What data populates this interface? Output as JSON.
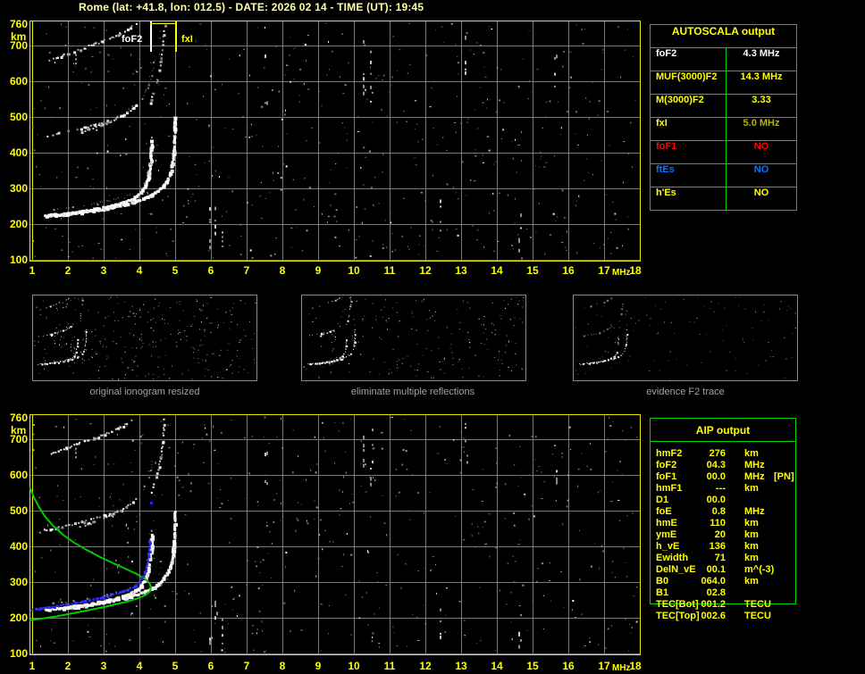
{
  "title": "Rome (lat: +41.8, lon: 012.5) - DATE: 2026 02 14 - TIME (UT): 19:45",
  "colors": {
    "background": "#000000",
    "axis_text": "#ffff00",
    "title_text": "#ffffa6",
    "grid": "#787878",
    "plot_border": "#e8e800",
    "table_border": "#00d400",
    "trace_white": "#ffffff",
    "profile_green": "#00cc00",
    "restored_blue": "#2525ff",
    "caption_gray": "#a2a2a2",
    "red": "#ff0000",
    "blue_text": "#0078ff",
    "olive_value": "#b4b400"
  },
  "annotations": {
    "foF2_label": "foF2",
    "fxI_label": "fxI",
    "foF2_mhz": 4.3,
    "fxI_mhz": 5.0
  },
  "axes": {
    "x_ticks": [
      1,
      2,
      3,
      4,
      5,
      6,
      7,
      8,
      9,
      10,
      11,
      12,
      13,
      14,
      15,
      16,
      17,
      18
    ],
    "x_unit": "MHz",
    "y_ticks": [
      760,
      700,
      600,
      500,
      400,
      300,
      200,
      100
    ],
    "y_unit": "km"
  },
  "autoscala_table": {
    "header": "AUTOSCALA output",
    "rows": [
      {
        "label": "foF2",
        "label_color": "#ffffff",
        "value": "4.3 MHz",
        "value_color": "#ffffff"
      },
      {
        "label": "MUF(3000)F2",
        "label_color": "#ffff00",
        "value": "14.3 MHz",
        "value_color": "#ffff00"
      },
      {
        "label": "M(3000)F2",
        "label_color": "#ffff00",
        "value": "3.33",
        "value_color": "#ffff00"
      },
      {
        "label": "fxI",
        "label_color": "#ffff00",
        "value": "5.0 MHz",
        "value_color": "#b4b400"
      },
      {
        "label": "foF1",
        "label_color": "#ff0000",
        "value": "NO",
        "value_color": "#ff0000"
      },
      {
        "label": "ftEs",
        "label_color": "#0078ff",
        "value": "NO",
        "value_color": "#0078ff"
      },
      {
        "label": "h'Es",
        "label_color": "#ffff00",
        "value": "NO",
        "value_color": "#ffff00"
      }
    ]
  },
  "aip_table": {
    "header": "AIP output",
    "rows": [
      {
        "label": "hmF2",
        "value": "276",
        "unit": "km",
        "note": ""
      },
      {
        "label": "foF2",
        "value": "04.3",
        "unit": "MHz",
        "note": ""
      },
      {
        "label": "foF1",
        "value": "00.0",
        "unit": "MHz",
        "note": "[PN]"
      },
      {
        "label": "hmF1",
        "value": "---",
        "unit": "km",
        "note": ""
      },
      {
        "label": "D1",
        "value": "00.0",
        "unit": "",
        "note": ""
      },
      {
        "label": "foE",
        "value": "0.8",
        "unit": "MHz",
        "note": ""
      },
      {
        "label": "hmE",
        "value": "110",
        "unit": "km",
        "note": ""
      },
      {
        "label": "ymE",
        "value": "20",
        "unit": "km",
        "note": ""
      },
      {
        "label": "h_vE",
        "value": "136",
        "unit": "km",
        "note": ""
      },
      {
        "label": "Ewidth",
        "value": "71",
        "unit": "km",
        "note": ""
      },
      {
        "label": "DelN_vE",
        "value": "00.1",
        "unit": "m^(-3)",
        "note": ""
      },
      {
        "label": "B0",
        "value": "064.0",
        "unit": "km",
        "note": ""
      },
      {
        "label": "B1",
        "value": "02.8",
        "unit": "",
        "note": ""
      },
      {
        "label": "TEC[Bot]",
        "value": "001.2",
        "unit": "TECU",
        "note": ""
      },
      {
        "label": "TEC[Top]",
        "value": "002.6",
        "unit": "TECU",
        "note": ""
      }
    ]
  },
  "thumbnails": [
    {
      "caption": "original ionogram resized"
    },
    {
      "caption": "eliminate multiple reflections"
    },
    {
      "caption": "evidence F2 trace"
    }
  ],
  "chart_data": {
    "type": "scatter",
    "x_unit": "MHz",
    "y_unit": "km",
    "x_range": [
      1,
      18
    ],
    "y_range": [
      100,
      760
    ],
    "grid": true,
    "traces": {
      "f2_ordinary": [
        [
          1.32,
          227
        ],
        [
          1.6,
          229
        ],
        [
          1.9,
          232
        ],
        [
          2.2,
          236
        ],
        [
          2.5,
          241
        ],
        [
          2.8,
          246
        ],
        [
          3.1,
          252
        ],
        [
          3.35,
          258
        ],
        [
          3.55,
          264
        ],
        [
          3.75,
          272
        ],
        [
          3.9,
          281
        ],
        [
          4.02,
          292
        ],
        [
          4.12,
          306
        ],
        [
          4.19,
          323
        ],
        [
          4.24,
          344
        ],
        [
          4.275,
          369
        ],
        [
          4.295,
          396
        ],
        [
          4.31,
          422
        ],
        [
          4.315,
          435
        ]
      ],
      "f2_extraordinary": [
        [
          1.75,
          229
        ],
        [
          2.05,
          232
        ],
        [
          2.35,
          236
        ],
        [
          2.65,
          240
        ],
        [
          2.95,
          245
        ],
        [
          3.25,
          251
        ],
        [
          3.55,
          258
        ],
        [
          3.85,
          266
        ],
        [
          4.1,
          275
        ],
        [
          4.3,
          285
        ],
        [
          4.5,
          297
        ],
        [
          4.65,
          311
        ],
        [
          4.76,
          327
        ],
        [
          4.84,
          347
        ],
        [
          4.895,
          372
        ],
        [
          4.93,
          400
        ],
        [
          4.95,
          432
        ],
        [
          4.96,
          465
        ],
        [
          4.965,
          500
        ]
      ],
      "second_reflection_a": [
        [
          1.3,
          447
        ],
        [
          1.65,
          454
        ],
        [
          2.0,
          462
        ],
        [
          2.35,
          470
        ],
        [
          2.7,
          479
        ],
        [
          3.0,
          488
        ],
        [
          3.3,
          498
        ],
        [
          3.55,
          508
        ]
      ],
      "second_reflection_b": [
        [
          2.3,
          457
        ],
        [
          2.6,
          467
        ],
        [
          2.9,
          478
        ],
        [
          3.2,
          490
        ],
        [
          3.45,
          503
        ],
        [
          3.65,
          516
        ],
        [
          3.8,
          528
        ],
        [
          3.95,
          542
        ]
      ],
      "second_reflection_c": [
        [
          4.28,
          543
        ],
        [
          4.38,
          568
        ],
        [
          4.47,
          598
        ],
        [
          4.54,
          632
        ],
        [
          4.6,
          668
        ],
        [
          4.64,
          705
        ],
        [
          4.67,
          742
        ],
        [
          4.68,
          758
        ]
      ],
      "second_reflection_d": [
        [
          4.05,
          555
        ],
        [
          4.18,
          577
        ],
        [
          4.28,
          602
        ],
        [
          4.35,
          630
        ],
        [
          4.4,
          660
        ]
      ],
      "third_reflection": [
        [
          1.45,
          660
        ],
        [
          1.7,
          669
        ],
        [
          1.95,
          678
        ],
        [
          2.2,
          687
        ],
        [
          2.45,
          696
        ],
        [
          2.7,
          705
        ],
        [
          2.95,
          714
        ],
        [
          3.2,
          724
        ],
        [
          3.45,
          735
        ],
        [
          3.65,
          746
        ],
        [
          3.78,
          755
        ]
      ],
      "vertical_dots": [
        [
          2.2,
          652
        ],
        [
          2.2,
          664
        ],
        [
          2.2,
          676
        ]
      ]
    },
    "bottom_overlays": {
      "electron_density_profile_green": [
        [
          0.93,
          566
        ],
        [
          1.05,
          537
        ],
        [
          1.2,
          508
        ],
        [
          1.38,
          481
        ],
        [
          1.6,
          456
        ],
        [
          1.87,
          432
        ],
        [
          2.18,
          410
        ],
        [
          2.52,
          390
        ],
        [
          2.88,
          371
        ],
        [
          3.24,
          354
        ],
        [
          3.6,
          338
        ],
        [
          3.92,
          323
        ],
        [
          4.15,
          309
        ],
        [
          4.28,
          297
        ],
        [
          4.33,
          286
        ],
        [
          4.3,
          274
        ],
        [
          4.18,
          264
        ],
        [
          3.95,
          254
        ],
        [
          3.65,
          245
        ],
        [
          3.3,
          237
        ],
        [
          2.92,
          228
        ],
        [
          2.52,
          220
        ],
        [
          2.1,
          212
        ],
        [
          1.68,
          204
        ],
        [
          1.3,
          198
        ],
        [
          0.93,
          193
        ]
      ],
      "restored_trace_blue": [
        [
          0.95,
          224
        ],
        [
          1.2,
          228
        ],
        [
          1.45,
          232
        ],
        [
          1.7,
          236
        ],
        [
          1.95,
          240
        ],
        [
          2.2,
          244
        ],
        [
          2.45,
          249
        ],
        [
          2.7,
          254
        ],
        [
          2.95,
          260
        ],
        [
          3.2,
          266
        ],
        [
          3.45,
          273
        ],
        [
          3.65,
          280
        ],
        [
          3.82,
          289
        ],
        [
          3.95,
          300
        ],
        [
          4.05,
          313
        ],
        [
          4.13,
          329
        ],
        [
          4.19,
          349
        ],
        [
          4.23,
          372
        ],
        [
          4.255,
          397
        ],
        [
          4.27,
          418
        ]
      ],
      "blue_isolated_point": [
        4.3,
        525
      ]
    },
    "noise": {
      "seed_top": 101,
      "seed_bottom": 202,
      "seed_thumbs": [
        7,
        8,
        9
      ],
      "count_top": 560,
      "count_bottom": 530,
      "count_thumbs": [
        300,
        190,
        110
      ],
      "rfi_columns": [
        {
          "f": 10.25,
          "km": [
            560,
            740
          ],
          "n": 7
        },
        {
          "f": 10.45,
          "km": [
            540,
            730
          ],
          "n": 6
        },
        {
          "f": 13.1,
          "km": [
            600,
            750
          ],
          "n": 5
        },
        {
          "f": 15.6,
          "km": [
            580,
            700
          ],
          "n": 4
        },
        {
          "f": 6.1,
          "km": [
            140,
            260
          ],
          "n": 5
        },
        {
          "f": 6.3,
          "km": [
            120,
            200
          ],
          "n": 4
        },
        {
          "f": 5.95,
          "km": [
            130,
            250
          ],
          "n": 5
        },
        {
          "f": 14.6,
          "km": [
            120,
            240
          ],
          "n": 5
        },
        {
          "f": 12.4,
          "km": [
            150,
            280
          ],
          "n": 4
        },
        {
          "f": 7.5,
          "km": [
            540,
            680
          ],
          "n": 4
        }
      ]
    }
  }
}
